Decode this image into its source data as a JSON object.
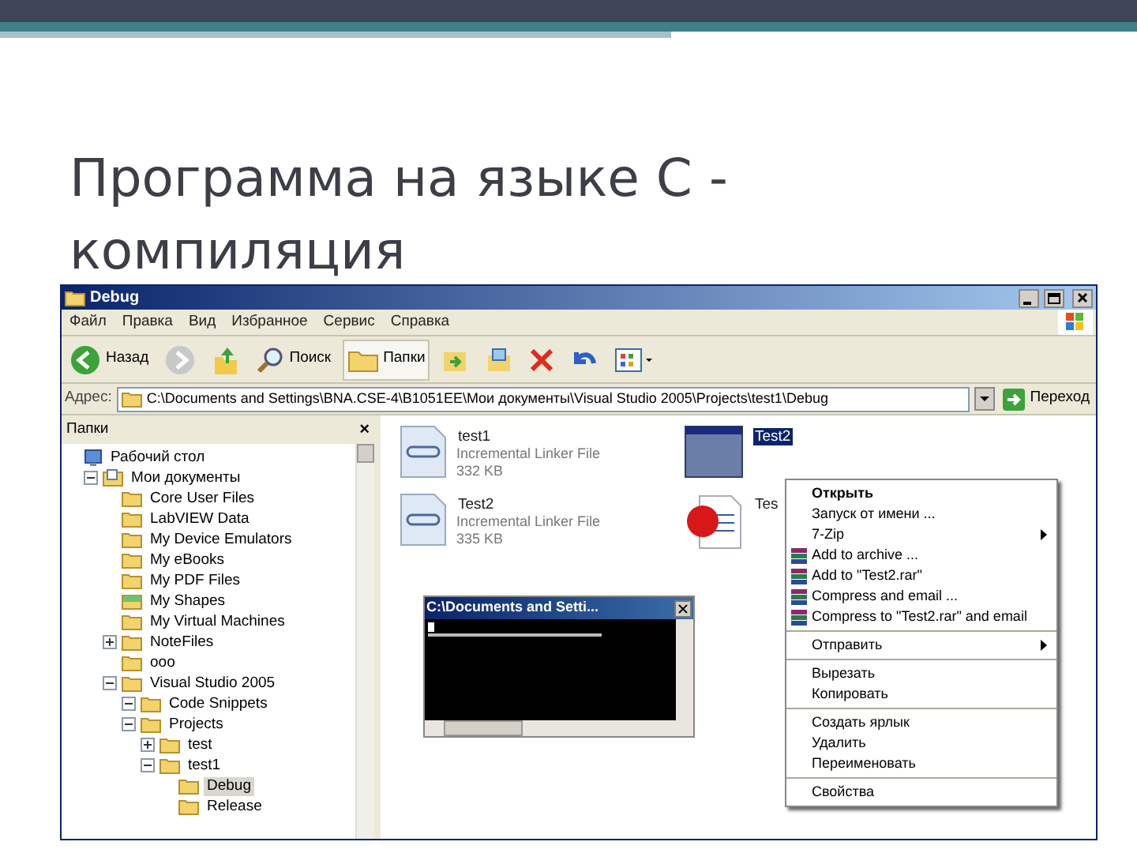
{
  "slide": {
    "title": "Программа на языке С - компиляция"
  },
  "window": {
    "title": "Debug",
    "menu": [
      "Файл",
      "Правка",
      "Вид",
      "Избранное",
      "Сервис",
      "Справка"
    ],
    "toolbar": [
      {
        "kind": "back",
        "label": "Назад",
        "selected": false
      },
      {
        "kind": "forward",
        "selected": false
      },
      {
        "kind": "up",
        "selected": false
      },
      {
        "kind": "search",
        "label": "Поиск",
        "selected": false
      },
      {
        "kind": "folders",
        "label": "Папки",
        "selected": true
      },
      {
        "kind": "move",
        "selected": false
      },
      {
        "kind": "copy",
        "selected": false
      },
      {
        "kind": "delete",
        "selected": false
      },
      {
        "kind": "undo",
        "selected": false
      },
      {
        "kind": "views",
        "selected": false
      }
    ],
    "address": {
      "label": "Адрес:",
      "value": "C:\\Documents and Settings\\BNA.CSE-4\\B1051EE\\Мои документы\\Visual Studio 2005\\Projects\\test1\\Debug",
      "go": "Переход"
    },
    "folders_pane": {
      "title": "Папки",
      "close": "×",
      "tree": [
        {
          "name": "Рабочий стол",
          "selected": false,
          "children": [
            {
              "name": "Мои документы",
              "selected": false,
              "expanded": true,
              "children": [
                {
                  "name": "Core User Files",
                  "selected": false
                },
                {
                  "name": "LabVIEW Data",
                  "selected": false
                },
                {
                  "name": "My Device Emulators",
                  "selected": false
                },
                {
                  "name": "My eBooks",
                  "selected": false
                },
                {
                  "name": "My PDF Files",
                  "selected": false
                },
                {
                  "name": "My Shapes",
                  "selected": false
                },
                {
                  "name": "My Virtual Machines",
                  "selected": false
                },
                {
                  "name": "NoteFiles",
                  "selected": false,
                  "expanded": false
                },
                {
                  "name": "ooo",
                  "selected": false
                },
                {
                  "name": "Visual Studio 2005",
                  "selected": false,
                  "expanded": true,
                  "children": [
                    {
                      "name": "Code Snippets",
                      "selected": false,
                      "expanded": true
                    },
                    {
                      "name": "Projects",
                      "selected": false,
                      "expanded": true,
                      "children": [
                        {
                          "name": "test",
                          "selected": false,
                          "expanded": false
                        },
                        {
                          "name": "test1",
                          "selected": false,
                          "expanded": true,
                          "children": [
                            {
                              "name": "Debug",
                              "selected": true
                            },
                            {
                              "name": "Release",
                              "selected": false
                            }
                          ]
                        }
                      ]
                    }
                  ]
                }
              ]
            }
          ]
        }
      ]
    },
    "files": [
      {
        "kind": "linker",
        "name": "test1",
        "type": "Incremental Linker File",
        "size": "332 KB",
        "selected": false
      },
      {
        "kind": "exe",
        "name": "Test2",
        "selected": true
      },
      {
        "kind": "linker",
        "name": "Test2",
        "type": "Incremental Linker File",
        "size": "335 KB",
        "selected": false
      },
      {
        "kind": "debug",
        "name": "Tes",
        "selected": false
      }
    ],
    "console": {
      "title": "C:\\Documents and Setti..."
    },
    "context_menu": [
      {
        "kind": "item",
        "label": "Открыть",
        "default": true,
        "submenu": false,
        "icon": false
      },
      {
        "kind": "item",
        "label": "Запуск от имени ...",
        "default": false,
        "submenu": false,
        "icon": false
      },
      {
        "kind": "item",
        "label": "7-Zip",
        "default": false,
        "submenu": true,
        "icon": false
      },
      {
        "kind": "item",
        "label": "Add to archive ...",
        "default": false,
        "submenu": false,
        "icon": true
      },
      {
        "kind": "item",
        "label": "Add to \"Test2.rar\"",
        "default": false,
        "submenu": false,
        "icon": true
      },
      {
        "kind": "item",
        "label": "Compress and email ...",
        "default": false,
        "submenu": false,
        "icon": true
      },
      {
        "kind": "item",
        "label": "Compress to \"Test2.rar\" and email",
        "default": false,
        "submenu": false,
        "icon": true
      },
      {
        "kind": "separator"
      },
      {
        "kind": "item",
        "label": "Отправить",
        "default": false,
        "submenu": true,
        "icon": false
      },
      {
        "kind": "separator"
      },
      {
        "kind": "item",
        "label": "Вырезать",
        "default": false,
        "submenu": false,
        "icon": false
      },
      {
        "kind": "item",
        "label": "Копировать",
        "default": false,
        "submenu": false,
        "icon": false
      },
      {
        "kind": "separator"
      },
      {
        "kind": "item",
        "label": "Создать ярлык",
        "default": false,
        "submenu": false,
        "icon": false
      },
      {
        "kind": "item",
        "label": "Удалить",
        "default": false,
        "submenu": false,
        "icon": false
      },
      {
        "kind": "item",
        "label": "Переименовать",
        "default": false,
        "submenu": false,
        "icon": false
      },
      {
        "kind": "separator"
      },
      {
        "kind": "item",
        "label": "Свойства",
        "default": false,
        "submenu": false,
        "icon": false
      }
    ]
  }
}
